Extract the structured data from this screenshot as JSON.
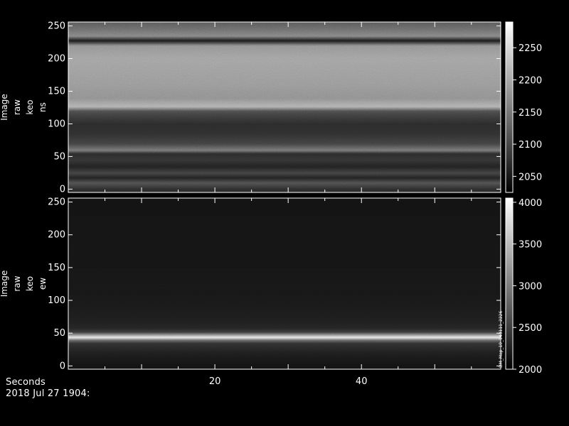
{
  "chart_data": [
    {
      "type": "heatmap",
      "ylabel_lines": [
        "Image",
        "raw",
        "keo",
        "ns"
      ],
      "xlim": [
        0,
        59
      ],
      "ylim": [
        -5,
        256
      ],
      "yticks": [
        0,
        50,
        100,
        150,
        200,
        250
      ],
      "colorbar": {
        "range": [
          2025,
          2290
        ],
        "ticks": [
          2050,
          2100,
          2150,
          2200,
          2250
        ]
      },
      "intensity_profile": {
        "rows": [
          0,
          10,
          18,
          25,
          35,
          45,
          55,
          60,
          70,
          85,
          100,
          110,
          120,
          127,
          140,
          160,
          180,
          200,
          220,
          228,
          235,
          245,
          256
        ],
        "values": [
          2070,
          2110,
          2060,
          2095,
          2060,
          2080,
          2070,
          2150,
          2095,
          2075,
          2070,
          2085,
          2105,
          2210,
          2175,
          2185,
          2190,
          2195,
          2180,
          2050,
          2165,
          2140,
          2120
        ]
      }
    },
    {
      "type": "heatmap",
      "ylabel_lines": [
        "Image",
        "raw",
        "keo",
        "ew"
      ],
      "xlim": [
        0,
        59
      ],
      "ylim": [
        -5,
        256
      ],
      "yticks": [
        0,
        50,
        100,
        150,
        200,
        250
      ],
      "colorbar": {
        "range": [
          2000,
          4050
        ],
        "ticks": [
          2000,
          2500,
          3000,
          3500,
          4000
        ],
        "side_label": "DM_Map_19_143111_2226"
      },
      "intensity_profile": {
        "rows": [
          0,
          20,
          35,
          40,
          44,
          48,
          52,
          58,
          70,
          100,
          150,
          200,
          256
        ],
        "values": [
          2150,
          2250,
          2400,
          2900,
          3900,
          3200,
          2500,
          2300,
          2250,
          2200,
          2180,
          2170,
          2160
        ]
      }
    }
  ],
  "shared_x": {
    "xticks": [
      20,
      40
    ],
    "xlabel": "Seconds"
  },
  "footer": {
    "line1": "Seconds",
    "line2": "2018 Jul 27 1904:"
  }
}
